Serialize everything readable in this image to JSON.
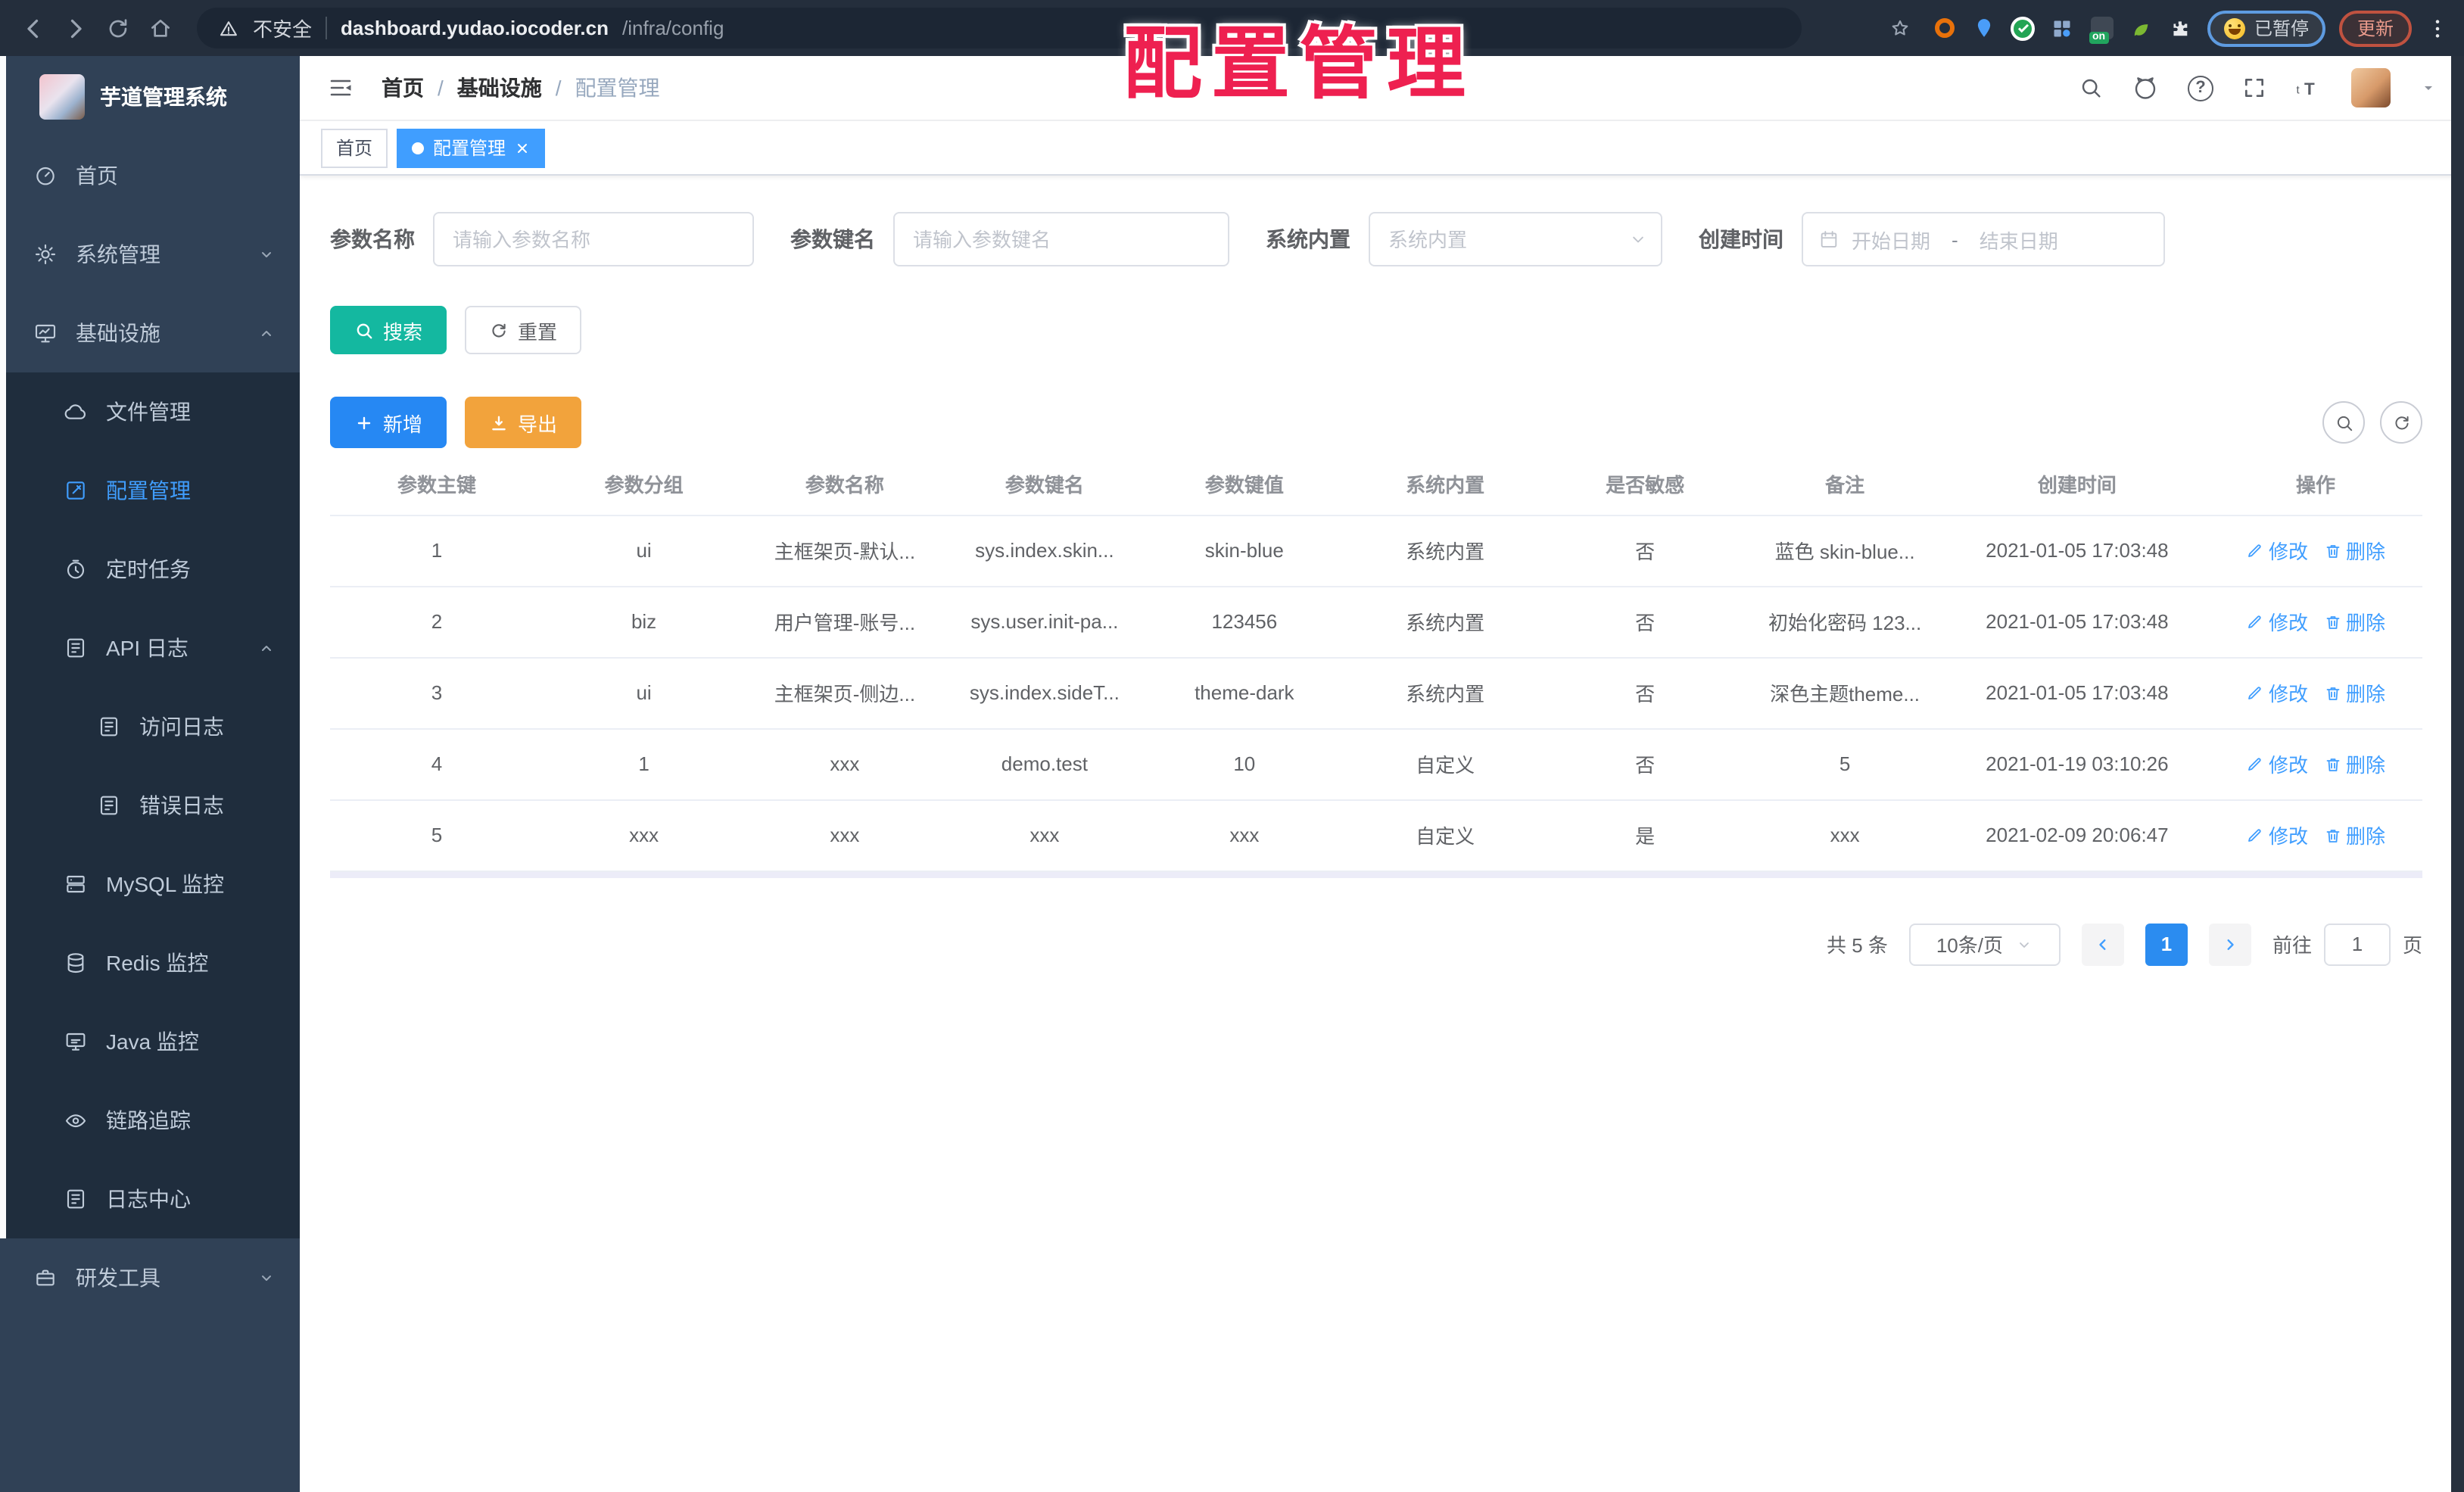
{
  "browser": {
    "security_label": "不安全",
    "url_host": "dashboard.yudao.iocoder.cn",
    "url_path": "/infra/config",
    "paused_label": "已暂停",
    "update_label": "更新",
    "extensions": [
      {
        "id": "orange-ring",
        "color": "#e8710a",
        "style": "ring"
      },
      {
        "id": "blue-pin",
        "color": "#4a9df8",
        "style": "pin"
      },
      {
        "id": "green-check",
        "color": "#23a454",
        "style": "check"
      },
      {
        "id": "blue-grid",
        "color": "#8fa9cc",
        "style": "grid"
      },
      {
        "id": "on-badge",
        "color": "#21a55e",
        "style": "badge",
        "label": "on"
      },
      {
        "id": "green-leaf",
        "color": "#7cb832",
        "style": "leaf"
      },
      {
        "id": "puzzle",
        "color": "#e8eaed",
        "style": "puzzle"
      }
    ]
  },
  "watermark": "配置管理",
  "sidebar": {
    "title": "芋道管理系统",
    "items": [
      {
        "id": "home",
        "label": "首页",
        "icon": "dashboard",
        "level": 0
      },
      {
        "id": "system-management",
        "label": "系统管理",
        "icon": "gear",
        "level": 0,
        "chevron": "down"
      },
      {
        "id": "infrastructure",
        "label": "基础设施",
        "icon": "monitor",
        "level": 0,
        "chevron": "up"
      },
      {
        "id": "file-management",
        "label": "文件管理",
        "icon": "cloud",
        "level": 1,
        "sub": true
      },
      {
        "id": "config-management",
        "label": "配置管理",
        "icon": "edit-square",
        "level": 1,
        "sub": true,
        "active": true
      },
      {
        "id": "scheduled-tasks",
        "label": "定时任务",
        "icon": "timer",
        "level": 1,
        "sub": true
      },
      {
        "id": "api-logs",
        "label": "API 日志",
        "icon": "doc-pen",
        "level": 1,
        "sub": true,
        "chevron": "up"
      },
      {
        "id": "access-logs",
        "label": "访问日志",
        "icon": "doc-pen",
        "level": 2,
        "sub": true
      },
      {
        "id": "error-logs",
        "label": "错误日志",
        "icon": "doc-pen",
        "level": 2,
        "sub": true
      },
      {
        "id": "mysql-monitor",
        "label": "MySQL 监控",
        "icon": "server",
        "level": 1,
        "sub": true
      },
      {
        "id": "redis-monitor",
        "label": "Redis 监控",
        "icon": "database",
        "level": 1,
        "sub": true
      },
      {
        "id": "java-monitor",
        "label": "Java 监控",
        "icon": "java-monitor",
        "level": 1,
        "sub": true
      },
      {
        "id": "trace",
        "label": "链路追踪",
        "icon": "eye",
        "level": 1,
        "sub": true
      },
      {
        "id": "log-center",
        "label": "日志中心",
        "icon": "doc-pen",
        "level": 1,
        "sub": true
      },
      {
        "id": "dev-tools",
        "label": "研发工具",
        "icon": "briefcase",
        "level": 0,
        "chevron": "down"
      }
    ]
  },
  "header": {
    "breadcrumb": [
      "首页",
      "基础设施",
      "配置管理"
    ]
  },
  "tabs": [
    {
      "label": "首页",
      "active": false
    },
    {
      "label": "配置管理",
      "active": true,
      "closable": true
    }
  ],
  "filters": [
    {
      "label": "参数名称",
      "type": "input",
      "placeholder": "请输入参数名称"
    },
    {
      "label": "参数键名",
      "type": "input",
      "placeholder": "请输入参数键名"
    },
    {
      "label": "系统内置",
      "type": "select",
      "placeholder": "系统内置"
    },
    {
      "label": "创建时间",
      "type": "daterange",
      "start_placeholder": "开始日期",
      "separator": "-",
      "end_placeholder": "结束日期"
    }
  ],
  "toolbar": {
    "search_label": "搜索",
    "reset_label": "重置",
    "add_label": "新增",
    "export_label": "导出"
  },
  "table": {
    "headers": [
      "参数主键",
      "参数分组",
      "参数名称",
      "参数键名",
      "参数键值",
      "系统内置",
      "是否敏感",
      "备注",
      "创建时间",
      "操作"
    ],
    "rows": [
      [
        "1",
        "ui",
        "主框架页-默认...",
        "sys.index.skin...",
        "skin-blue",
        "系统内置",
        "否",
        "蓝色 skin-blue...",
        "2021-01-05 17:03:48"
      ],
      [
        "2",
        "biz",
        "用户管理-账号...",
        "sys.user.init-pa...",
        "123456",
        "系统内置",
        "否",
        "初始化密码 123...",
        "2021-01-05 17:03:48"
      ],
      [
        "3",
        "ui",
        "主框架页-侧边...",
        "sys.index.sideT...",
        "theme-dark",
        "系统内置",
        "否",
        "深色主题theme...",
        "2021-01-05 17:03:48"
      ],
      [
        "4",
        "1",
        "xxx",
        "demo.test",
        "10",
        "自定义",
        "否",
        "5",
        "2021-01-19 03:10:26"
      ],
      [
        "5",
        "xxx",
        "xxx",
        "xxx",
        "xxx",
        "自定义",
        "是",
        "xxx",
        "2021-02-09 20:06:47"
      ]
    ],
    "actions": [
      "修改",
      "删除"
    ]
  },
  "pagination": {
    "total_label": "共 5 条",
    "page_size_label": "10条/页",
    "current_page": "1",
    "goto_label": "前往",
    "goto_value": "1",
    "page_unit": "页"
  },
  "colors": {
    "accent": "#409eff",
    "sidebar_bg": "#304156",
    "submenu_bg": "#1f2d3d",
    "search_button": "#14b8a0",
    "add_button": "#2688f3",
    "export_button": "#f2a33c",
    "active_page_bg": "#2b8cf0",
    "watermark_red": "#ee2050"
  }
}
